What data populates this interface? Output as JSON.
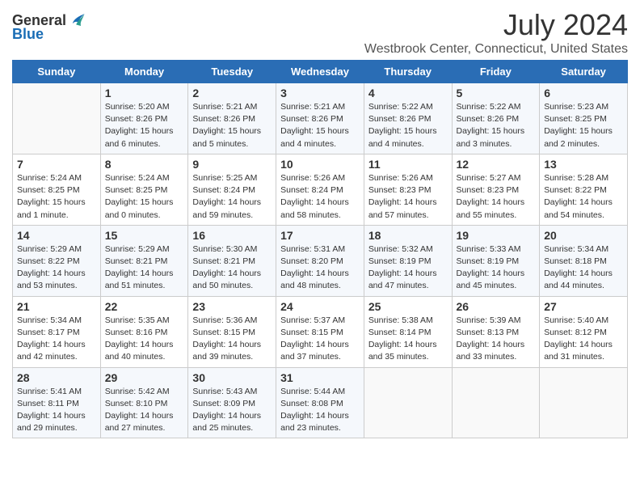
{
  "header": {
    "logo_general": "General",
    "logo_blue": "Blue",
    "main_title": "July 2024",
    "subtitle": "Westbrook Center, Connecticut, United States"
  },
  "days_of_week": [
    "Sunday",
    "Monday",
    "Tuesday",
    "Wednesday",
    "Thursday",
    "Friday",
    "Saturday"
  ],
  "weeks": [
    [
      {
        "day": "",
        "info": ""
      },
      {
        "day": "1",
        "info": "Sunrise: 5:20 AM\nSunset: 8:26 PM\nDaylight: 15 hours\nand 6 minutes."
      },
      {
        "day": "2",
        "info": "Sunrise: 5:21 AM\nSunset: 8:26 PM\nDaylight: 15 hours\nand 5 minutes."
      },
      {
        "day": "3",
        "info": "Sunrise: 5:21 AM\nSunset: 8:26 PM\nDaylight: 15 hours\nand 4 minutes."
      },
      {
        "day": "4",
        "info": "Sunrise: 5:22 AM\nSunset: 8:26 PM\nDaylight: 15 hours\nand 4 minutes."
      },
      {
        "day": "5",
        "info": "Sunrise: 5:22 AM\nSunset: 8:26 PM\nDaylight: 15 hours\nand 3 minutes."
      },
      {
        "day": "6",
        "info": "Sunrise: 5:23 AM\nSunset: 8:25 PM\nDaylight: 15 hours\nand 2 minutes."
      }
    ],
    [
      {
        "day": "7",
        "info": "Sunrise: 5:24 AM\nSunset: 8:25 PM\nDaylight: 15 hours\nand 1 minute."
      },
      {
        "day": "8",
        "info": "Sunrise: 5:24 AM\nSunset: 8:25 PM\nDaylight: 15 hours\nand 0 minutes."
      },
      {
        "day": "9",
        "info": "Sunrise: 5:25 AM\nSunset: 8:24 PM\nDaylight: 14 hours\nand 59 minutes."
      },
      {
        "day": "10",
        "info": "Sunrise: 5:26 AM\nSunset: 8:24 PM\nDaylight: 14 hours\nand 58 minutes."
      },
      {
        "day": "11",
        "info": "Sunrise: 5:26 AM\nSunset: 8:23 PM\nDaylight: 14 hours\nand 57 minutes."
      },
      {
        "day": "12",
        "info": "Sunrise: 5:27 AM\nSunset: 8:23 PM\nDaylight: 14 hours\nand 55 minutes."
      },
      {
        "day": "13",
        "info": "Sunrise: 5:28 AM\nSunset: 8:22 PM\nDaylight: 14 hours\nand 54 minutes."
      }
    ],
    [
      {
        "day": "14",
        "info": "Sunrise: 5:29 AM\nSunset: 8:22 PM\nDaylight: 14 hours\nand 53 minutes."
      },
      {
        "day": "15",
        "info": "Sunrise: 5:29 AM\nSunset: 8:21 PM\nDaylight: 14 hours\nand 51 minutes."
      },
      {
        "day": "16",
        "info": "Sunrise: 5:30 AM\nSunset: 8:21 PM\nDaylight: 14 hours\nand 50 minutes."
      },
      {
        "day": "17",
        "info": "Sunrise: 5:31 AM\nSunset: 8:20 PM\nDaylight: 14 hours\nand 48 minutes."
      },
      {
        "day": "18",
        "info": "Sunrise: 5:32 AM\nSunset: 8:19 PM\nDaylight: 14 hours\nand 47 minutes."
      },
      {
        "day": "19",
        "info": "Sunrise: 5:33 AM\nSunset: 8:19 PM\nDaylight: 14 hours\nand 45 minutes."
      },
      {
        "day": "20",
        "info": "Sunrise: 5:34 AM\nSunset: 8:18 PM\nDaylight: 14 hours\nand 44 minutes."
      }
    ],
    [
      {
        "day": "21",
        "info": "Sunrise: 5:34 AM\nSunset: 8:17 PM\nDaylight: 14 hours\nand 42 minutes."
      },
      {
        "day": "22",
        "info": "Sunrise: 5:35 AM\nSunset: 8:16 PM\nDaylight: 14 hours\nand 40 minutes."
      },
      {
        "day": "23",
        "info": "Sunrise: 5:36 AM\nSunset: 8:15 PM\nDaylight: 14 hours\nand 39 minutes."
      },
      {
        "day": "24",
        "info": "Sunrise: 5:37 AM\nSunset: 8:15 PM\nDaylight: 14 hours\nand 37 minutes."
      },
      {
        "day": "25",
        "info": "Sunrise: 5:38 AM\nSunset: 8:14 PM\nDaylight: 14 hours\nand 35 minutes."
      },
      {
        "day": "26",
        "info": "Sunrise: 5:39 AM\nSunset: 8:13 PM\nDaylight: 14 hours\nand 33 minutes."
      },
      {
        "day": "27",
        "info": "Sunrise: 5:40 AM\nSunset: 8:12 PM\nDaylight: 14 hours\nand 31 minutes."
      }
    ],
    [
      {
        "day": "28",
        "info": "Sunrise: 5:41 AM\nSunset: 8:11 PM\nDaylight: 14 hours\nand 29 minutes."
      },
      {
        "day": "29",
        "info": "Sunrise: 5:42 AM\nSunset: 8:10 PM\nDaylight: 14 hours\nand 27 minutes."
      },
      {
        "day": "30",
        "info": "Sunrise: 5:43 AM\nSunset: 8:09 PM\nDaylight: 14 hours\nand 25 minutes."
      },
      {
        "day": "31",
        "info": "Sunrise: 5:44 AM\nSunset: 8:08 PM\nDaylight: 14 hours\nand 23 minutes."
      },
      {
        "day": "",
        "info": ""
      },
      {
        "day": "",
        "info": ""
      },
      {
        "day": "",
        "info": ""
      }
    ]
  ]
}
